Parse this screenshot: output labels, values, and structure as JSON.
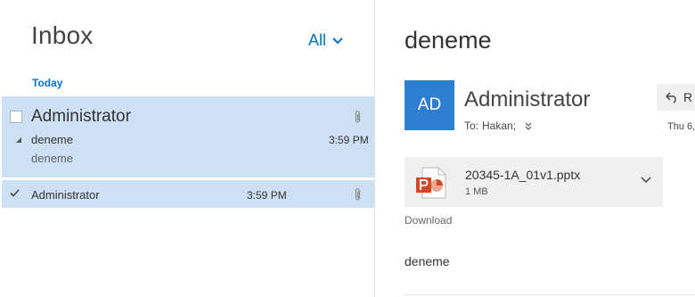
{
  "list": {
    "title": "Inbox",
    "filter_label": "All",
    "group_header": "Today",
    "messages": [
      {
        "sender": "Administrator",
        "subject": "deneme",
        "preview": "deneme",
        "time": "3:59 PM",
        "has_attachment": true,
        "selected": true
      },
      {
        "sender": "Administrator",
        "time": "3:59 PM",
        "has_attachment": true,
        "selected": true
      }
    ]
  },
  "reading": {
    "subject": "deneme",
    "avatar_initials": "AD",
    "from_name": "Administrator",
    "to_label": "To:",
    "to_recipient": "Hakan;",
    "reply_label": "R",
    "date_short": "Thu 6,",
    "attachment": {
      "name": "20345-1A_01v1.pptx",
      "size": "1 MB",
      "type_icon": "powerpoint-file-icon"
    },
    "download_label": "Download",
    "body": "deneme"
  },
  "colors": {
    "accent": "#0072c6",
    "selected_row": "#cde0f4",
    "avatar_bg": "#2e7fd2",
    "powerpoint": "#d24726"
  }
}
